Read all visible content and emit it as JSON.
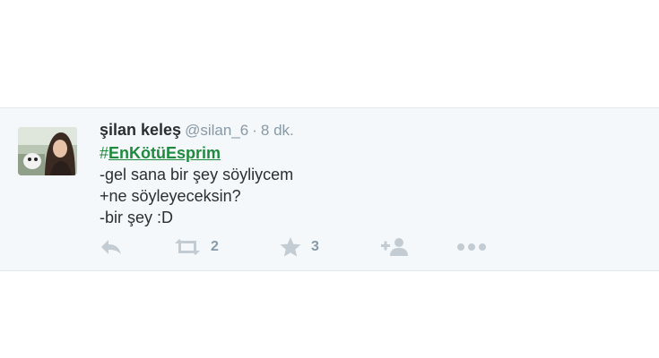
{
  "tweet": {
    "fullname": "şilan keleş",
    "username": "@silan_6",
    "separator": "·",
    "time": "8 dk.",
    "hashtag_symbol": "#",
    "hashtag_text": "EnKötüEsprim",
    "lines": [
      "-gel sana bir şey söyliycem",
      "+ne söyleyeceksin?",
      "-bir şey :D"
    ]
  },
  "actions": {
    "reply_icon": "reply-icon",
    "retweet_icon": "retweet-icon",
    "retweet_count": "2",
    "favorite_icon": "star-icon",
    "favorite_count": "3",
    "follow_icon": "follow-user-icon",
    "more_icon": "more-dots-icon"
  },
  "colors": {
    "hashtag": "#1f8a3e",
    "muted": "#8899a6",
    "icon": "#c3ccd3",
    "background": "#f5f8fa",
    "text": "#292f33"
  }
}
